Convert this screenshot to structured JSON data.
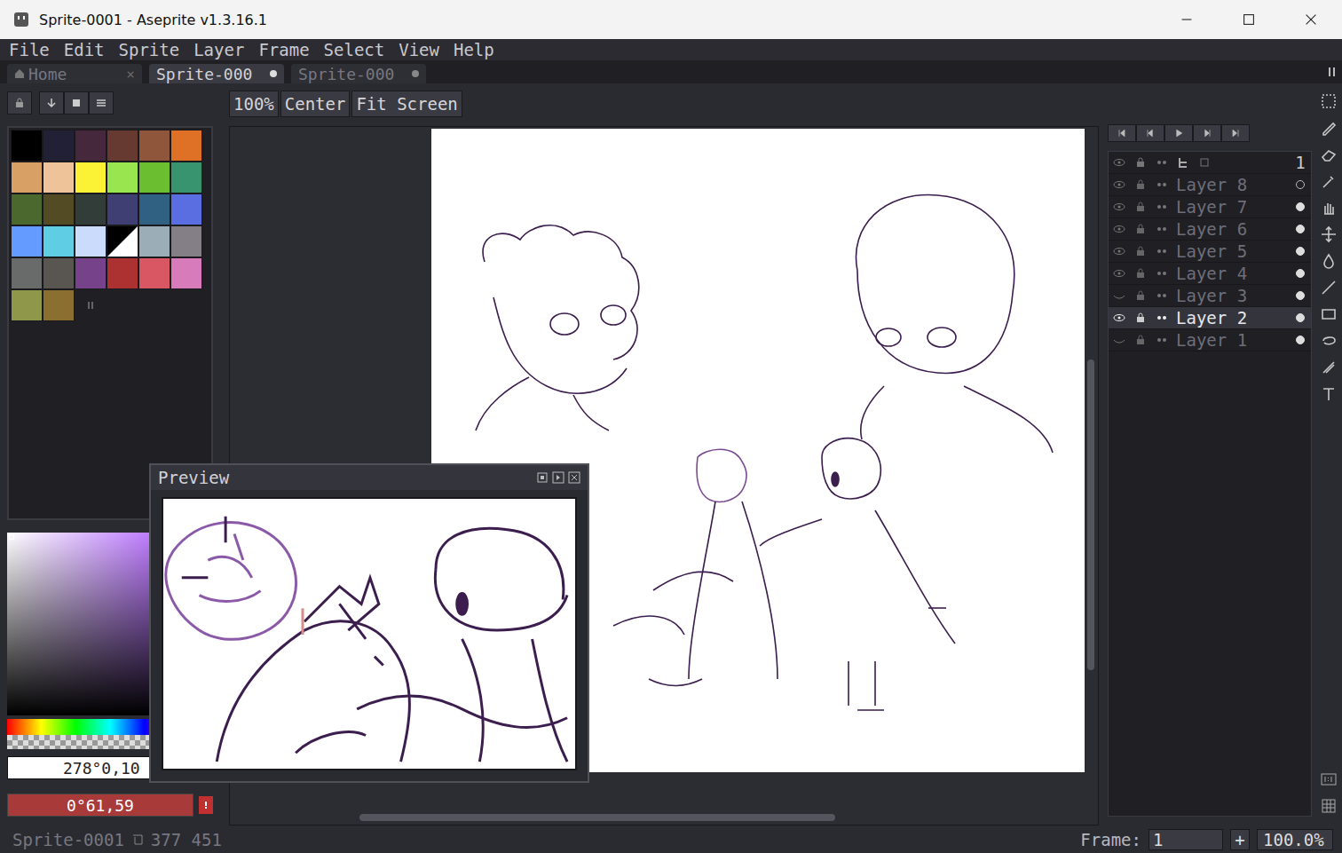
{
  "window": {
    "title": "Sprite-0001 - Aseprite v1.3.16.1"
  },
  "menu": [
    "File",
    "Edit",
    "Sprite",
    "Layer",
    "Frame",
    "Select",
    "View",
    "Help"
  ],
  "tabs": [
    {
      "label": "Home",
      "selected": false,
      "modified": false,
      "close": "×"
    },
    {
      "label": "Sprite-000",
      "selected": true,
      "modified": true,
      "close": ""
    },
    {
      "label": "Sprite-000",
      "selected": false,
      "modified": true,
      "close": ""
    }
  ],
  "zoom_buttons": [
    "100%",
    "Center",
    "Fit Screen"
  ],
  "palette": [
    {
      "color": "#000000",
      "selected": false
    },
    {
      "color": "#222034",
      "selected": false
    },
    {
      "color": "#45283c",
      "selected": false
    },
    {
      "color": "#663931",
      "selected": false
    },
    {
      "color": "#8f563b",
      "selected": false
    },
    {
      "color": "#df7126",
      "selected": false
    },
    {
      "color": "#d9a066",
      "selected": false
    },
    {
      "color": "#eec39a",
      "selected": false
    },
    {
      "color": "#fbf236",
      "selected": false
    },
    {
      "color": "#99e550",
      "selected": false
    },
    {
      "color": "#6abe30",
      "selected": false
    },
    {
      "color": "#37946e",
      "selected": false
    },
    {
      "color": "#4b692f",
      "selected": false
    },
    {
      "color": "#524b24",
      "selected": false
    },
    {
      "color": "#323c39",
      "selected": false
    },
    {
      "color": "#3f3f74",
      "selected": false
    },
    {
      "color": "#306082",
      "selected": false
    },
    {
      "color": "#5b6ee1",
      "selected": false
    },
    {
      "color": "#639bff",
      "selected": false
    },
    {
      "color": "#5fcde4",
      "selected": false
    },
    {
      "color": "#cbdbfc",
      "selected": false
    },
    {
      "color": "#ffffff",
      "selected": true
    },
    {
      "color": "#9badb7",
      "selected": false
    },
    {
      "color": "#847e87",
      "selected": false
    },
    {
      "color": "#696a6a",
      "selected": false
    },
    {
      "color": "#595652",
      "selected": false
    },
    {
      "color": "#76428a",
      "selected": false
    },
    {
      "color": "#ac3232",
      "selected": false
    },
    {
      "color": "#d95763",
      "selected": false
    },
    {
      "color": "#d77bba",
      "selected": false
    },
    {
      "color": "#8f974a",
      "selected": false
    },
    {
      "color": "#8a6f30",
      "selected": false
    }
  ],
  "color_fields": {
    "hsv": "278°0,10",
    "current": "0°61,59",
    "current_color": "#a83a3a"
  },
  "preview": {
    "title": "Preview"
  },
  "timeline": {
    "frame_header": "1",
    "layers": [
      {
        "name": "Layer 8",
        "visible": true,
        "selected": false,
        "cel": false
      },
      {
        "name": "Layer 7",
        "visible": true,
        "selected": false,
        "cel": true
      },
      {
        "name": "Layer 6",
        "visible": true,
        "selected": false,
        "cel": true
      },
      {
        "name": "Layer 5",
        "visible": true,
        "selected": false,
        "cel": true
      },
      {
        "name": "Layer 4",
        "visible": true,
        "selected": false,
        "cel": true
      },
      {
        "name": "Layer 3",
        "visible": false,
        "selected": false,
        "cel": true
      },
      {
        "name": "Layer 2",
        "visible": true,
        "selected": true,
        "cel": true
      },
      {
        "name": "Layer 1",
        "visible": false,
        "selected": false,
        "cel": true
      }
    ]
  },
  "status_bar": {
    "sprite": "Sprite-0001",
    "size": "377 451",
    "frame_label": "Frame:",
    "frame": "1",
    "add": "+",
    "zoom": "100.0%"
  }
}
